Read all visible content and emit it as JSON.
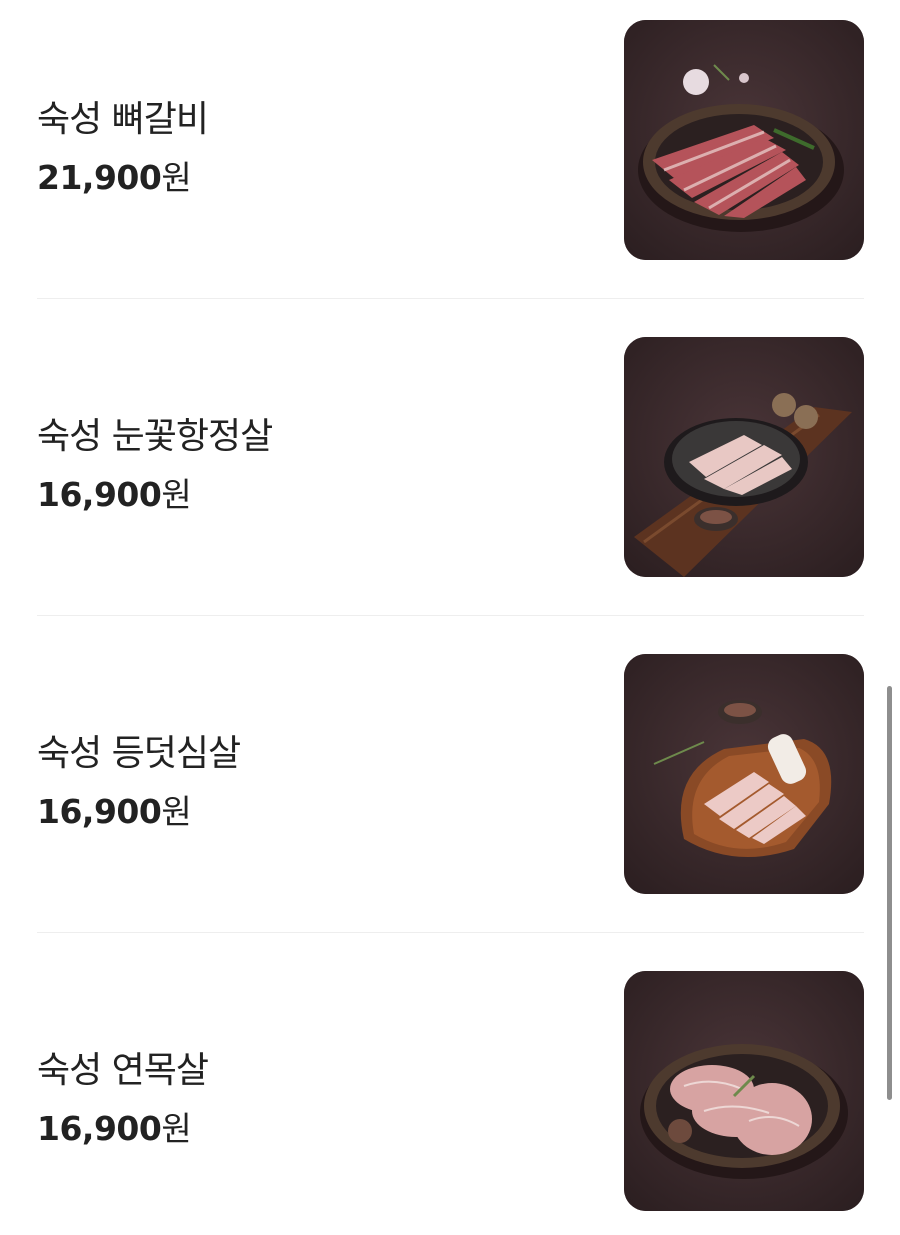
{
  "menu": {
    "items": [
      {
        "name": "숙성 뼈갈비",
        "price_number": "21,900",
        "price_unit": "원",
        "image_icon": "pork-rib-plate-photo"
      },
      {
        "name": "숙성 눈꽃항정살",
        "price_number": "16,900",
        "price_unit": "원",
        "image_icon": "pork-jowl-bowl-photo"
      },
      {
        "name": "숙성 등덧심살",
        "price_number": "16,900",
        "price_unit": "원",
        "image_icon": "pork-loin-board-photo"
      },
      {
        "name": "숙성 연목살",
        "price_number": "16,900",
        "price_unit": "원",
        "image_icon": "pork-neck-plate-photo"
      }
    ]
  },
  "colors": {
    "text": "#222222",
    "divider": "#eeeeee",
    "photo_background": "#3b2a2c",
    "scrollbar": "#8e8e8e"
  }
}
